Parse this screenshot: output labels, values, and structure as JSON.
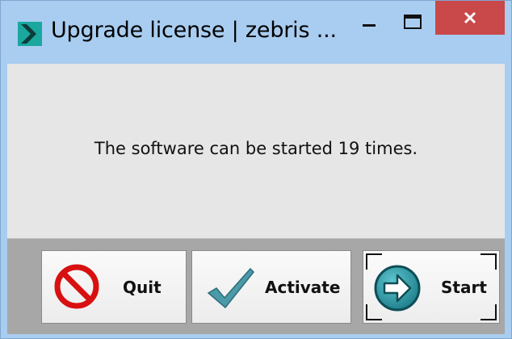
{
  "window": {
    "title": "Upgrade license | zebris ...",
    "controls": {
      "minimize_icon": "minimize-icon",
      "maximize_icon": "maximize-icon",
      "close_icon": "close-icon"
    }
  },
  "content": {
    "message": "The software can be started 19 times."
  },
  "buttons": {
    "quit": {
      "label": "Quit",
      "icon": "no-entry-icon"
    },
    "activate": {
      "label": "Activate",
      "icon": "checkmark-icon"
    },
    "start": {
      "label": "Start",
      "icon": "arrow-right-circle-icon"
    }
  },
  "colors": {
    "window_frame": "#a9cdf0",
    "close_button": "#c9484a",
    "content_bg": "#e6e6e6",
    "footer_bg": "#a7a7a7",
    "app_icon_teal": "#1aa79e"
  }
}
